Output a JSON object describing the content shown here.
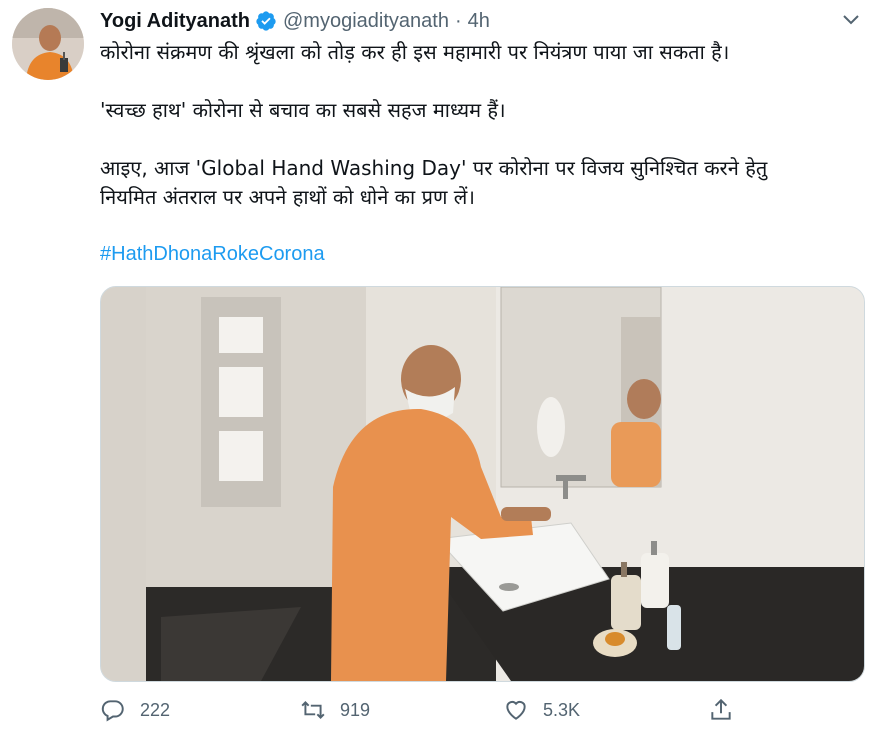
{
  "tweet": {
    "author_name": "Yogi Adityanath",
    "handle": "@myogiadityanath",
    "separator": "·",
    "time": "4h",
    "lines": [
      "कोरोना संक्रमण की श्रृंखला को तोड़ कर ही इस महामारी पर नियंत्रण पाया जा सकता है।",
      "'स्वच्छ हाथ' कोरोना से बचाव का सबसे सहज माध्यम हैं।",
      "आइए, आज 'Global Hand Washing Day' पर कोरोना पर विजय सुनिश्चित करने हेतु",
      "नियमित अंतराल पर अपने हाथों को धोने का प्रण लें।"
    ],
    "hashtag": "#HathDhonaRokeCorona"
  },
  "actions": {
    "replies": "222",
    "retweets": "919",
    "likes": "5.3K"
  },
  "colors": {
    "link": "#1d9bf0",
    "verified": "#1d9bf0",
    "secondary_text": "#536471"
  },
  "icons": {
    "reply": "reply-icon",
    "retweet": "retweet-icon",
    "like": "heart-icon",
    "share": "share-icon",
    "more": "chevron-down-icon",
    "verified": "verified-badge-icon"
  }
}
